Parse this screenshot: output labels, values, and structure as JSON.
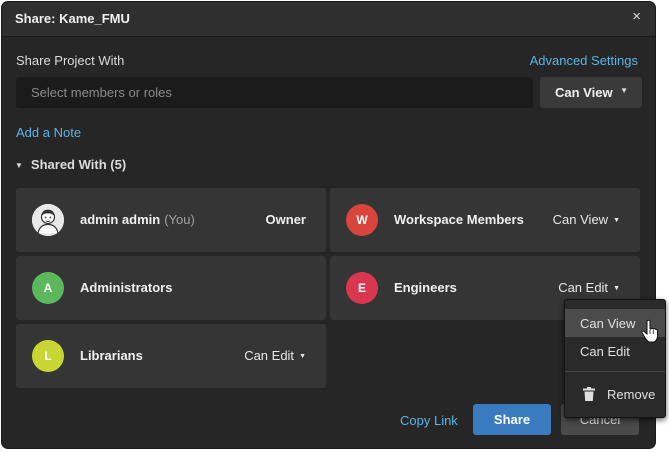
{
  "dialog": {
    "title": "Share: Kame_FMU",
    "close_glyph": "×",
    "share_project_label": "Share Project With",
    "advanced_settings": "Advanced Settings",
    "search_placeholder": "Select members or roles",
    "permission_button": {
      "label": "Can View",
      "caret": "▼"
    },
    "add_note": "Add a Note",
    "shared_with": {
      "label": "Shared With (5)",
      "toggle": "▼"
    }
  },
  "shares": [
    {
      "initial": "",
      "name": "admin admin",
      "suffix": "(You)",
      "role": "Owner",
      "avatar_color": "#e6e6e6",
      "avatar_icon": "user-portrait-icon"
    },
    {
      "initial": "W",
      "name": "Workspace Members",
      "permission": "Can View",
      "avatar_color": "#d9453c"
    },
    {
      "initial": "A",
      "name": "Administrators",
      "avatar_color": "#5cb85c"
    },
    {
      "initial": "E",
      "name": "Engineers",
      "permission": "Can Edit",
      "avatar_color": "#d9364f"
    },
    {
      "initial": "L",
      "name": "Librarians",
      "permission": "Can Edit",
      "avatar_color": "#c8d633"
    }
  ],
  "caret_glyph": "▼",
  "footer": {
    "copy_link": "Copy Link",
    "share": "Share",
    "cancel": "Cancel"
  },
  "permission_menu": {
    "items": [
      "Can View",
      "Can Edit"
    ],
    "selected": "Can View",
    "remove": "Remove",
    "remove_icon": "trash-icon"
  },
  "colors": {
    "accent_link": "#5ab4e8",
    "primary_button": "#3a7bbf",
    "dialog_bg": "#262626",
    "card_bg": "#353535"
  }
}
